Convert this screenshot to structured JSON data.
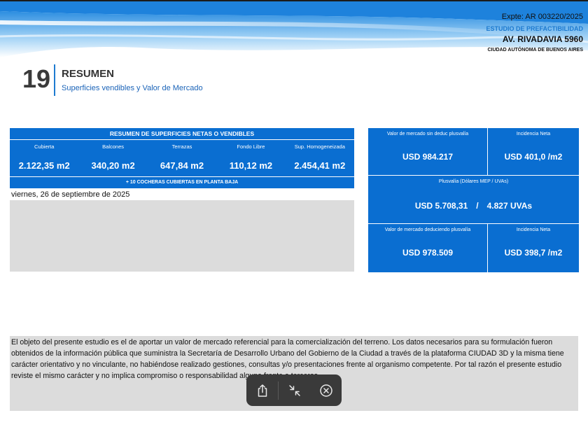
{
  "header": {
    "expte": "Expte: AR 003220/2025",
    "estudio": "ESTUDIO DE PREFACTIBILIDAD",
    "address": "AV. RIVADAVIA 5960",
    "city": "CIUDAD AUTÓNOMA DE BUENOS AIRES"
  },
  "section": {
    "number": "19",
    "title": "RESUMEN",
    "subtitle": "Superficies vendibles y Valor de Mercado"
  },
  "surfaces": {
    "title": "RESUMEN DE SUPERFICIES NETAS O VENDIBLES",
    "columns": [
      {
        "label": "Cubierta",
        "value": "2.122,35 m2"
      },
      {
        "label": "Balcones",
        "value": "340,20 m2"
      },
      {
        "label": "Terrazas",
        "value": "647,84 m2"
      },
      {
        "label": "Fondo Libre",
        "value": "110,12 m2"
      },
      {
        "label": "Sup. Homogeneizada",
        "value": "2.454,41 m2"
      }
    ],
    "note": "+ 10 COCHERAS CUBIERTAS EN PLANTA BAJA"
  },
  "date": "viernes, 26 de septiembre de 2025",
  "market": {
    "valor_sin_label": "Valor de mercado sin deduc plusvalía",
    "valor_sin_value": "USD  984.217",
    "incidencia1_label": "Incidencia Neta",
    "incidencia1_value": "USD  401,0 /m2",
    "plusvalia_label": "Plusvalía (Dólares MEP / UVAs)",
    "plusvalia_usd": "USD  5.708,31",
    "plusvalia_sep": "/",
    "plusvalia_uva": "4.827 UVAs",
    "valor_con_label": "Valor de mercado deduciendo plusvalía",
    "valor_con_value": "USD  978.509",
    "incidencia2_label": "Incidencia Neta",
    "incidencia2_value": "USD  398,7 /m2"
  },
  "disclaimer": "El objeto del presente estudio es el de aportar un valor de mercado referencial para la comercialización del terreno. Los datos necesarios para su formulación fueron obtenidos de la información pública que suministra la Secretaría de Desarrollo Urbano del Gobierno de la Ciudad a través de la plataforma CIUDAD 3D y la misma tiene carácter orientativo y no vinculante, no habiéndose realizado gestiones, consultas y/o presentaciones frente al organismo competente. Por tal razón el presente estudio reviste el mismo carácter y no implica compromiso o responsabilidad alguna frente a terceros.",
  "colors": {
    "accent": "#0a6ed1",
    "gray_box": "#dcdcdc",
    "toolbar": "#3a3a3a"
  },
  "toolbar": {
    "icons": [
      "share-icon",
      "collapse-icon",
      "close-circle-icon"
    ]
  }
}
